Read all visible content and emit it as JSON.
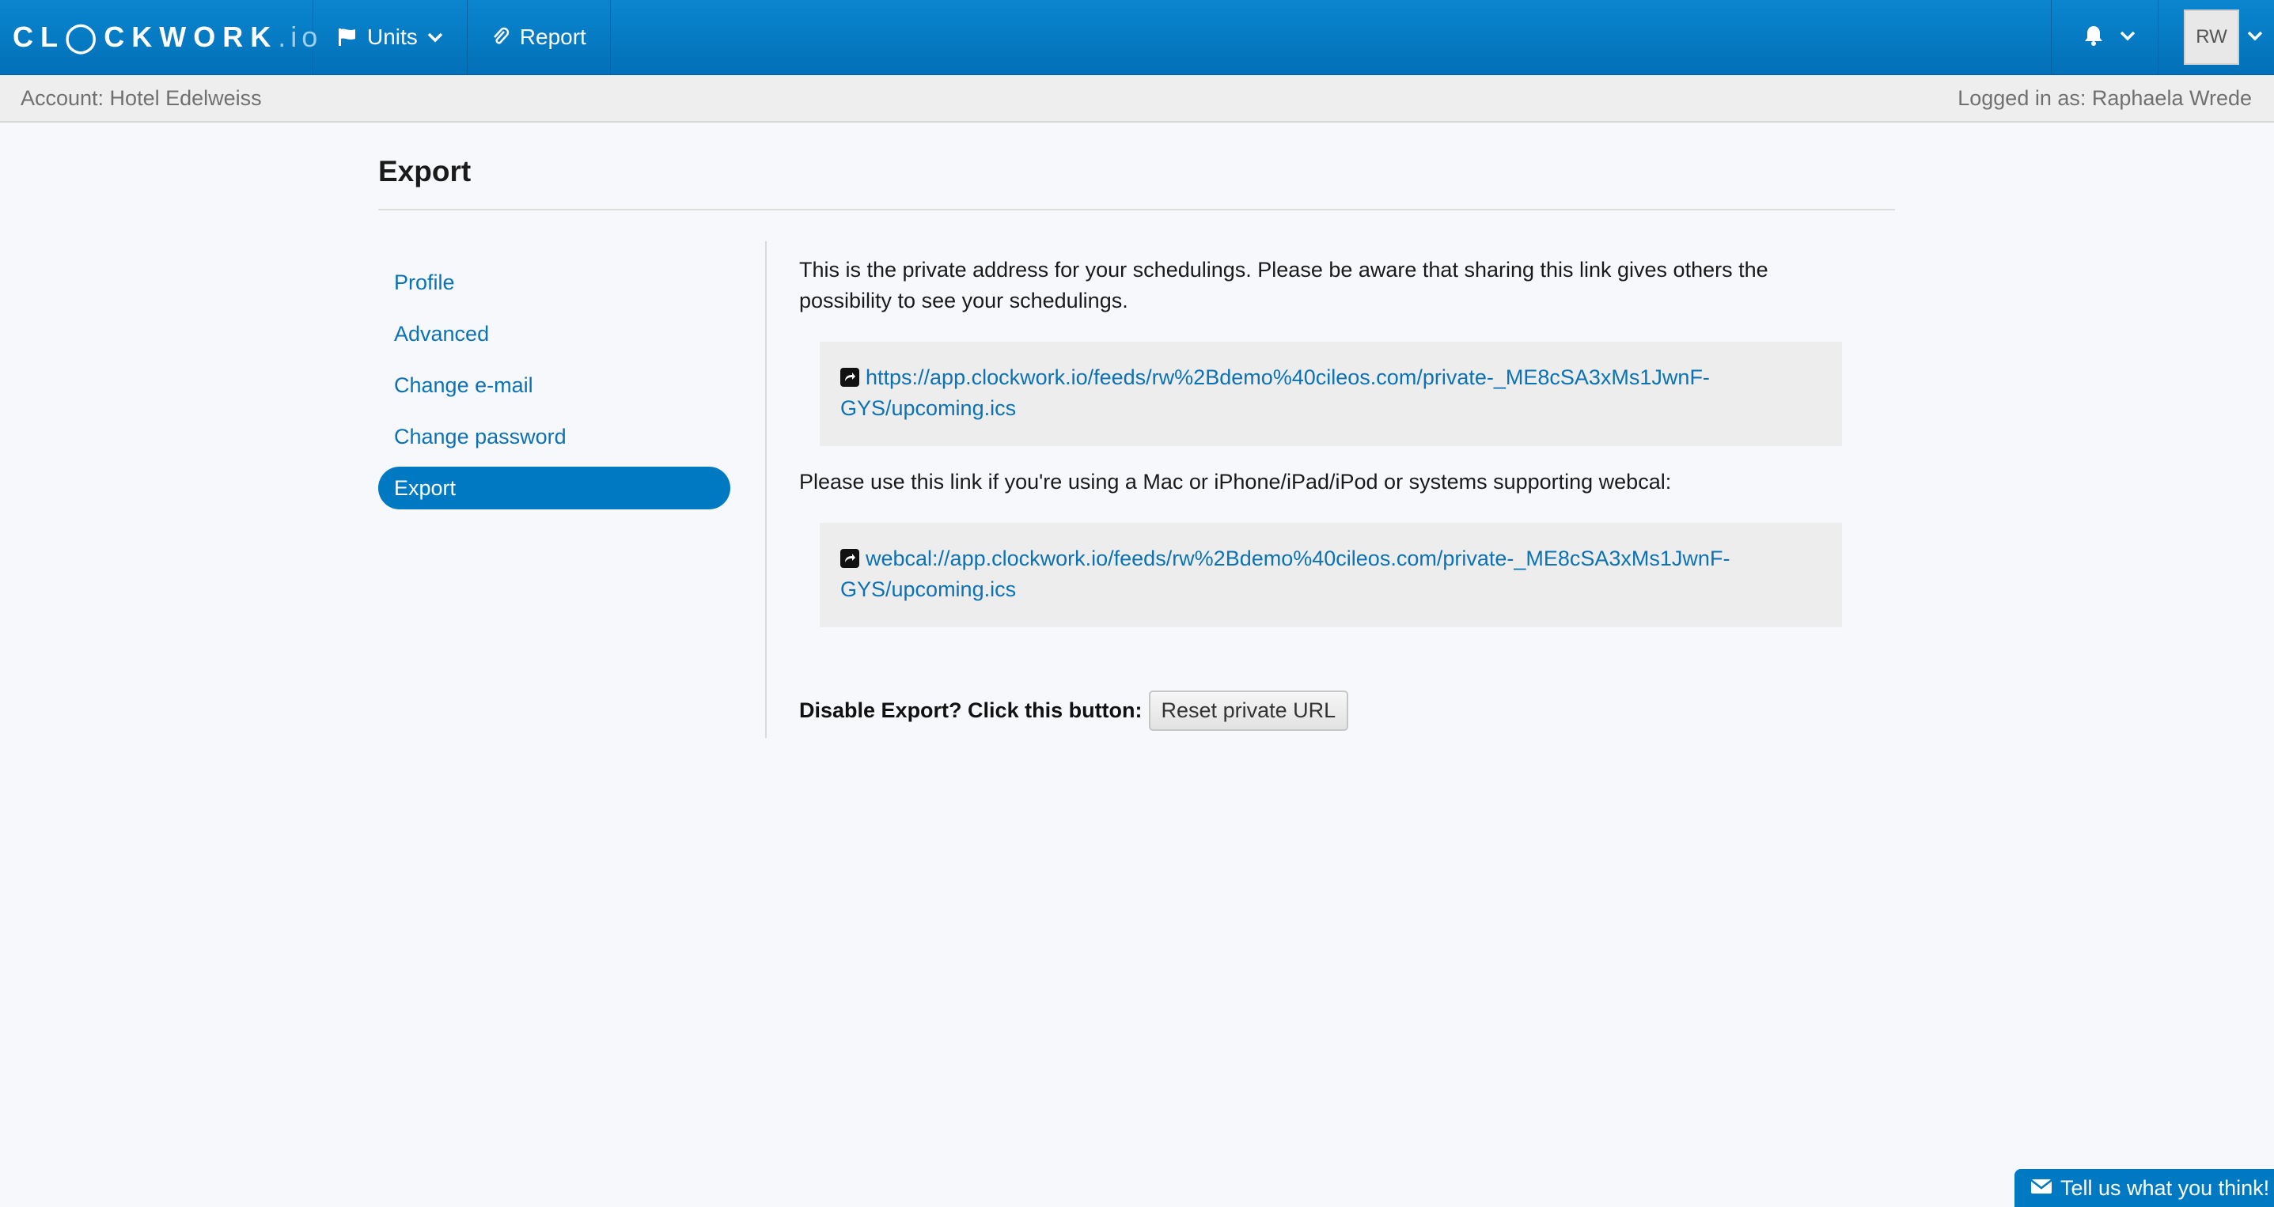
{
  "navbar": {
    "logo_main": "CL◯CKWORK",
    "logo_suffix": ".io",
    "units_label": "Units",
    "report_label": "Report",
    "avatar_initials": "RW"
  },
  "account_bar": {
    "account_text": "Account: Hotel Edelweiss",
    "logged_in_text": "Logged in as: Raphaela Wrede"
  },
  "page": {
    "title": "Export"
  },
  "sidebar": {
    "items": [
      {
        "label": "Profile"
      },
      {
        "label": "Advanced"
      },
      {
        "label": "Change e-mail"
      },
      {
        "label": "Change password"
      },
      {
        "label": "Export"
      }
    ],
    "active_index": 4
  },
  "main": {
    "intro_text": "This is the private address for your schedulings. Please be aware that sharing this link gives others the possibility to see your schedulings.",
    "https_link_line1": "https://app.clockwork.io/feeds/rw%2Bdemo%40cileos.com/private-_ME8cSA3xMs1JwnF-",
    "https_link_line2": "GYS/upcoming.ics",
    "webcal_text": "Please use this link if you're using a Mac or iPhone/iPad/iPod or systems supporting webcal:",
    "webcal_link_line1": "webcal://app.clockwork.io/feeds/rw%2Bdemo%40cileos.com/private-_ME8cSA3xMs1JwnF-",
    "webcal_link_line2": "GYS/upcoming.ics",
    "disable_label": "Disable Export? Click this button:",
    "reset_button": "Reset private URL"
  },
  "feedback": {
    "label": "Tell us what you think!"
  },
  "colors": {
    "navbar": "#0a86cf",
    "accent": "#0079c3",
    "link": "#0b72b5"
  }
}
